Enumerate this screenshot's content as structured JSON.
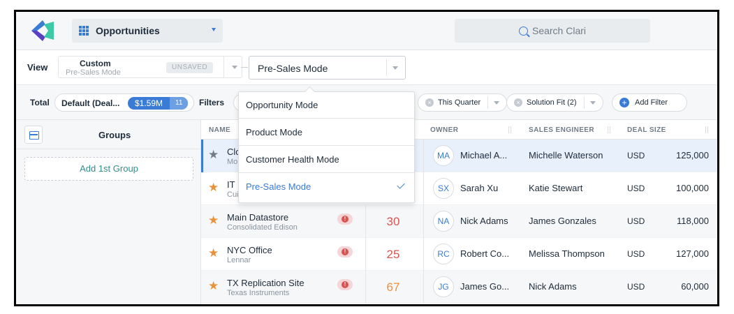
{
  "header": {
    "nav_label": "Opportunities",
    "search_placeholder": "Search Clari"
  },
  "viewbar": {
    "view_label": "View",
    "view_title": "Custom",
    "view_sub": "Pre-Sales Mode",
    "unsaved_badge": "UNSAVED",
    "mode_selected": "Pre-Sales Mode"
  },
  "filterbar": {
    "total_label": "Total",
    "default_label": "Default (Deal...",
    "amount": "$1.59M",
    "count": "11",
    "filters_label": "Filters",
    "chips": [
      "This Quarter",
      "Solution Fit (2)"
    ],
    "add_filter": "Add Filter"
  },
  "groups": {
    "title": "Groups",
    "add_button": "Add 1st Group"
  },
  "table": {
    "headers": {
      "name": "NAME",
      "owner": "OWNER",
      "se": "SALES ENGINEER",
      "deal": "DEAL SIZE"
    },
    "rows": [
      {
        "name": "Clo",
        "account": "Mo",
        "score": "",
        "initials": "MA",
        "owner": "Michael A...",
        "se": "Michelle Waterson",
        "currency": "USD",
        "amount": "125,000"
      },
      {
        "name": "IT",
        "account": "Cui",
        "score": "",
        "initials": "SX",
        "owner": "Sarah Xu",
        "se": "Katie Stewart",
        "currency": "USD",
        "amount": "100,000"
      },
      {
        "name": "Main Datastore",
        "account": "Consolidated Edison",
        "score": "30",
        "initials": "NA",
        "owner": "Nick Adams",
        "se": "James Gonzales",
        "currency": "USD",
        "amount": "118,000"
      },
      {
        "name": "NYC Office",
        "account": "Lennar",
        "score": "25",
        "initials": "RC",
        "owner": "Robert Co...",
        "se": "Melissa Thompson",
        "currency": "USD",
        "amount": "127,000"
      },
      {
        "name": "TX Replication Site",
        "account": "Texas Instruments",
        "score": "67",
        "initials": "JG",
        "owner": "James Go...",
        "se": "Nick Adams",
        "currency": "USD",
        "amount": "60,000"
      }
    ]
  },
  "dropdown": {
    "items": [
      "Opportunity Mode",
      "Product Mode",
      "Customer Health Mode",
      "Pre-Sales Mode"
    ]
  },
  "colors": {
    "accent": "#3a7bd5",
    "alert": "#d9534f",
    "star": "#e8923b",
    "teal": "#2f8f8a"
  }
}
